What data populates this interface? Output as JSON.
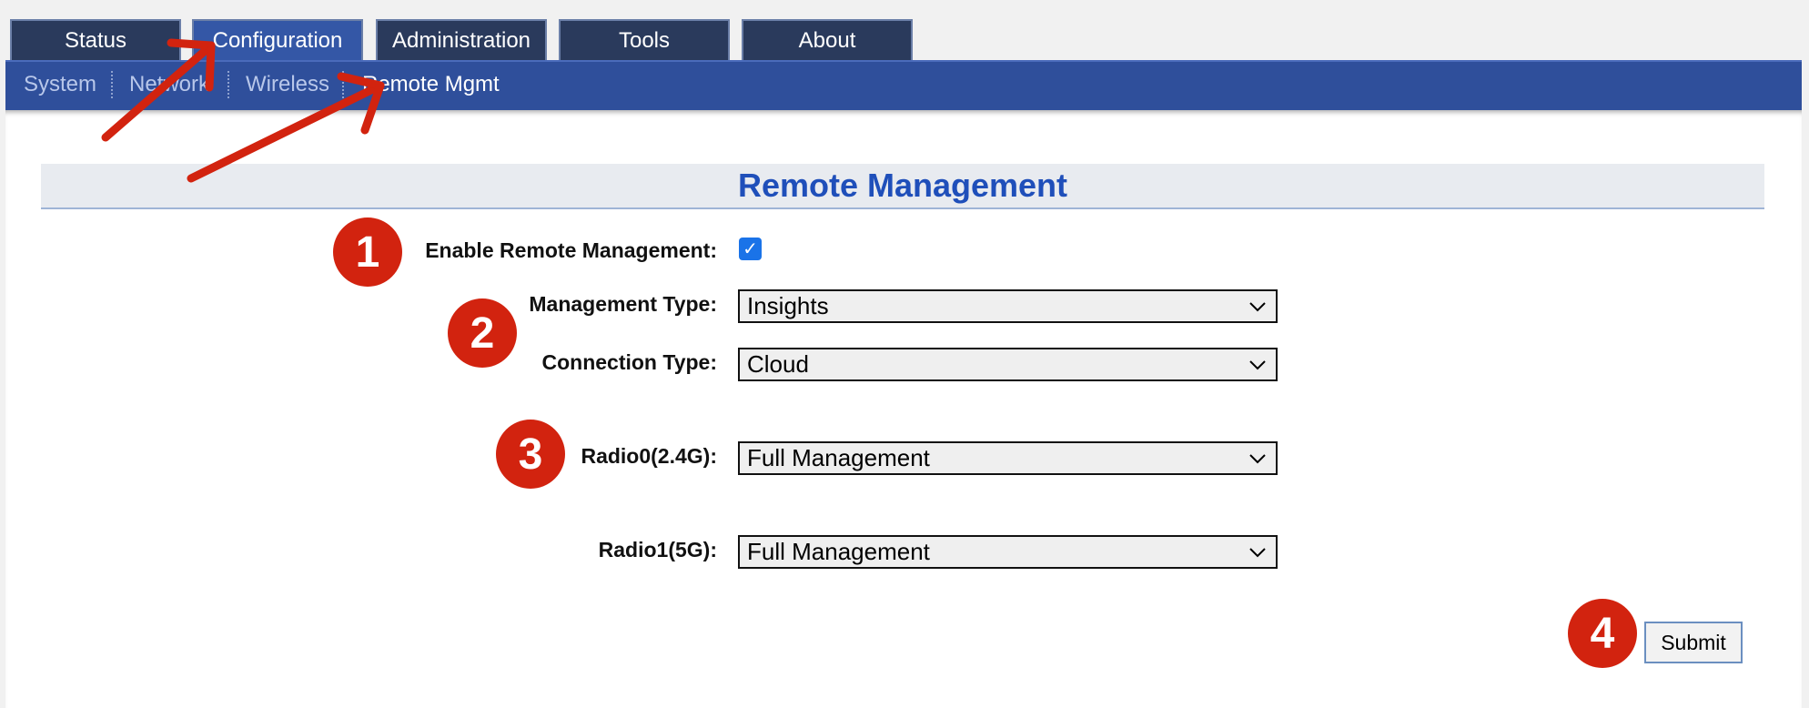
{
  "main_tabs": [
    {
      "label": "Status",
      "active": false
    },
    {
      "label": "Configuration",
      "active": true
    },
    {
      "label": "Administration",
      "active": false
    },
    {
      "label": "Tools",
      "active": false
    },
    {
      "label": "About",
      "active": false
    }
  ],
  "sub_tabs": [
    {
      "label": "System",
      "active": false
    },
    {
      "label": "Network",
      "active": false
    },
    {
      "label": "Wireless",
      "active": false
    },
    {
      "label": "Remote Mgmt",
      "active": true
    }
  ],
  "page": {
    "title": "Remote Management",
    "enable_label": "Enable Remote Management:",
    "enable_checked": true,
    "management_type_label": "Management Type:",
    "management_type_value": "Insights",
    "connection_type_label": "Connection Type:",
    "connection_type_value": "Cloud",
    "radio0_label": "Radio0(2.4G):",
    "radio0_value": "Full Management",
    "radio1_label": "Radio1(5G):",
    "radio1_value": "Full Management",
    "submit_label": "Submit"
  },
  "annotations": {
    "markers": [
      "1",
      "2",
      "3",
      "4"
    ],
    "color": "#d2230f"
  },
  "colors": {
    "tab_bg": "#2a3a5c",
    "tab_active": "#3457a6",
    "subnav_bg": "#2f4f9b",
    "title_color": "#1f4fba",
    "checkbox": "#1a73e8"
  }
}
